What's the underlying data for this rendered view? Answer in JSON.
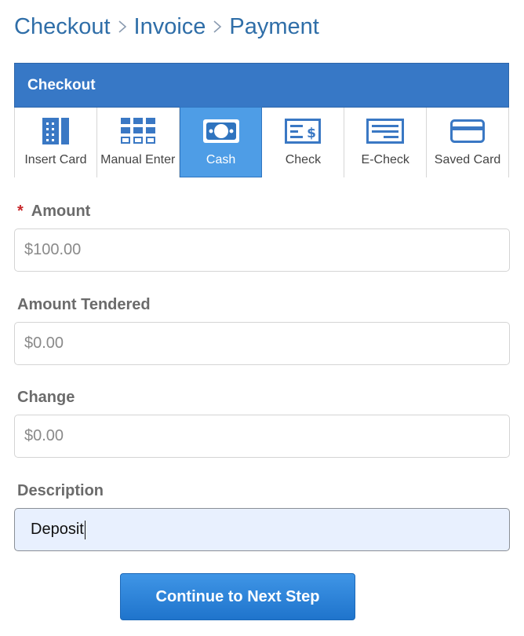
{
  "breadcrumb": {
    "items": [
      "Checkout",
      "Invoice",
      "Payment"
    ]
  },
  "panel": {
    "title": "Checkout",
    "methods": [
      {
        "label": "Insert Card",
        "icon": "card-reader-icon"
      },
      {
        "label": "Manual Enter",
        "icon": "keypad-icon"
      },
      {
        "label": "Cash",
        "icon": "cash-icon",
        "active": true
      },
      {
        "label": "Check",
        "icon": "check-icon"
      },
      {
        "label": "E-Check",
        "icon": "e-check-icon"
      },
      {
        "label": "Saved Card",
        "icon": "saved-card-icon"
      }
    ]
  },
  "fields": {
    "amount": {
      "label": "Amount",
      "required_mark": "*",
      "value": "$100.00"
    },
    "tendered": {
      "label": "Amount Tendered",
      "value": "$0.00"
    },
    "change": {
      "label": "Change",
      "value": "$0.00"
    },
    "description": {
      "label": "Description",
      "value": "Deposit"
    }
  },
  "button": {
    "label": "Continue to Next Step"
  },
  "colors": {
    "accent": "#3778c6",
    "active_tab": "#4e9de6",
    "link": "#2f6ea8",
    "required": "#c8282b",
    "icon": "#3a78c4"
  }
}
